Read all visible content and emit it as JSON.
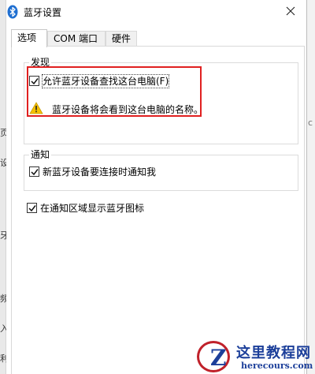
{
  "background_window": {
    "left_chars": [
      "页",
      "设",
      "牙",
      "频",
      "入",
      "利"
    ],
    "right_mark": "c"
  },
  "dialog": {
    "title": "蓝牙设置",
    "close_symbol": "×",
    "tabs": [
      {
        "label": "选项",
        "active": true
      },
      {
        "label": "COM 端口",
        "active": false
      },
      {
        "label": "硬件",
        "active": false
      }
    ],
    "discovery": {
      "title": "发现",
      "allow_checkbox": {
        "label": "允许蓝牙设备查找这台电脑(F)",
        "checked": true,
        "focused": true
      },
      "warning_text": "蓝牙设备将会看到这台电脑的名称。"
    },
    "notification": {
      "title": "通知",
      "notify_checkbox": {
        "label": "新蓝牙设备要连接时通知我",
        "checked": true
      }
    },
    "tray_checkbox": {
      "label": "在通知区域显示蓝牙图标",
      "checked": true
    }
  },
  "colors": {
    "highlight_box": "#e02020",
    "warning_fill": "#f5c000",
    "bluetooth_blue": "#1f6fd1",
    "watermark_blue": "#1c3f9a",
    "watermark_red": "#c0212a"
  },
  "watermark": {
    "logo_letter": "Z",
    "site_name": "这里教程网",
    "site_url": "herecours.com"
  }
}
